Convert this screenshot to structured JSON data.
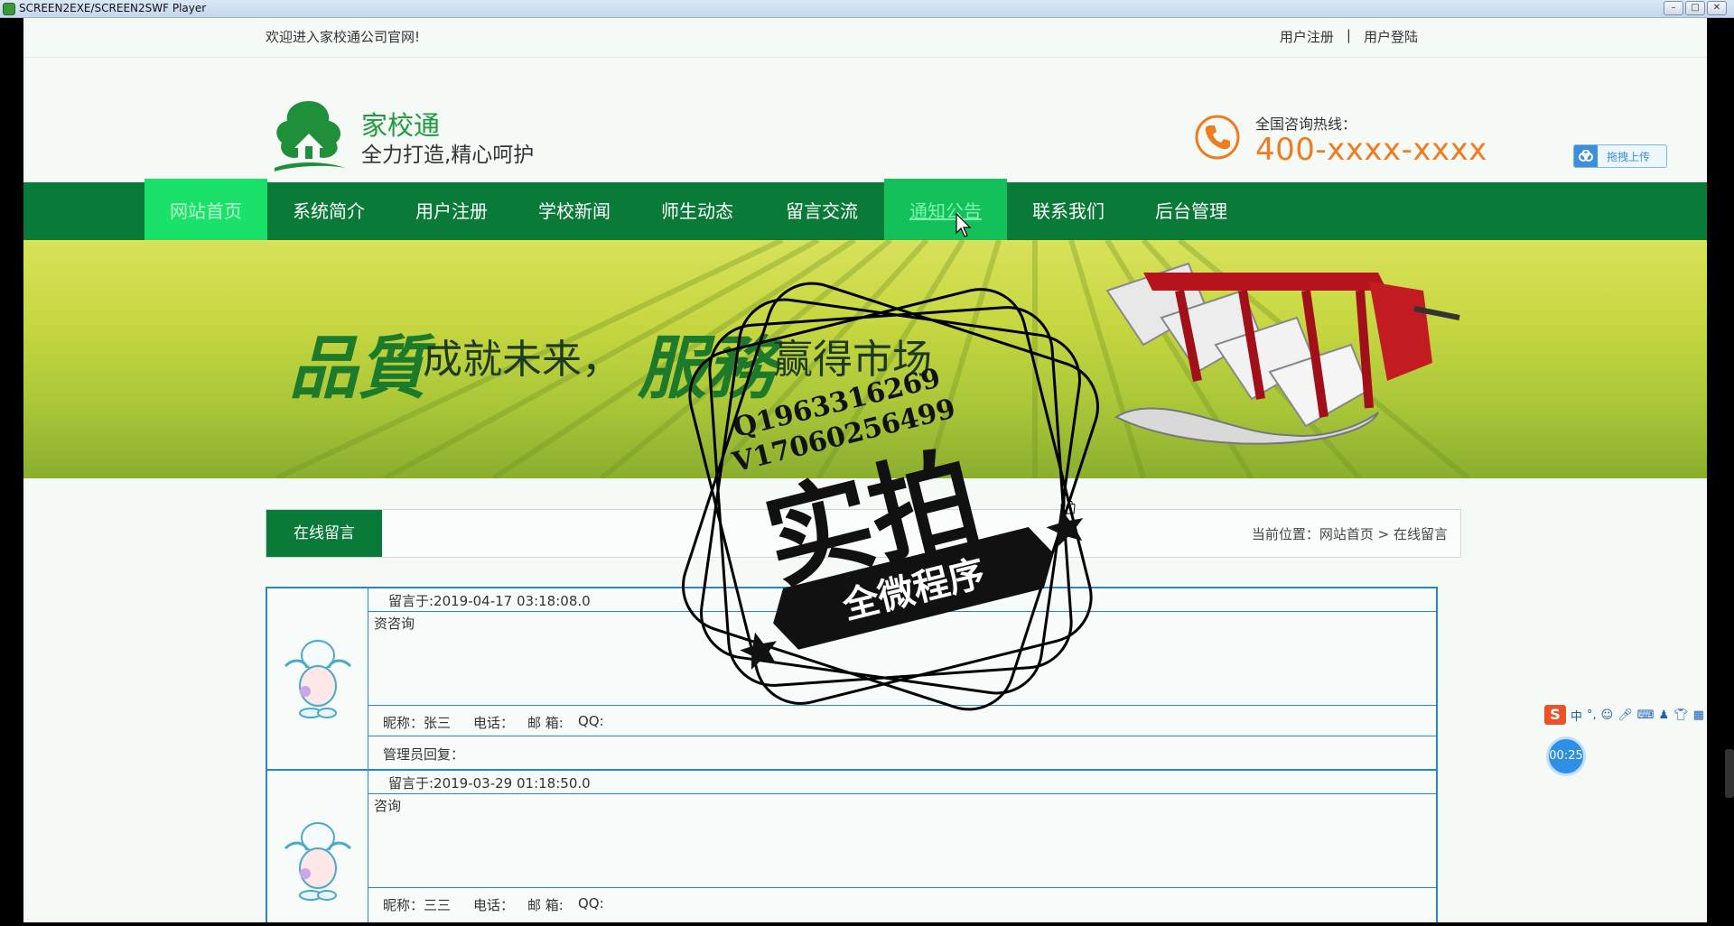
{
  "window": {
    "title": "SCREEN2EXE/SCREEN2SWF Player",
    "buttons": [
      "–",
      "□",
      "✕"
    ]
  },
  "topbar": {
    "welcome": "欢迎进入家校通公司官网!",
    "register": "用户注册",
    "separator": "|",
    "login": "用户登陆"
  },
  "header": {
    "brand_name": "家校通",
    "slogan": "全力打造,精心呵护",
    "hotline_label": "全国咨询热线：",
    "hotline_number": "400-xxxx-xxxx",
    "upload_label": "拖拽上传"
  },
  "nav": {
    "items": [
      {
        "label": "网站首页",
        "state": "active"
      },
      {
        "label": "系统简介",
        "state": "normal"
      },
      {
        "label": "用户注册",
        "state": "normal"
      },
      {
        "label": "学校新闻",
        "state": "normal"
      },
      {
        "label": "师生动态",
        "state": "normal"
      },
      {
        "label": "留言交流",
        "state": "normal"
      },
      {
        "label": "通知公告",
        "state": "hover"
      },
      {
        "label": "联系我们",
        "state": "normal"
      },
      {
        "label": "后台管理",
        "state": "normal"
      }
    ]
  },
  "banner": {
    "text_quality": "品質",
    "text_future": "成就未来，",
    "text_service": "服務",
    "text_market": "赢得市场"
  },
  "watermark": {
    "contact_q": "Q1963316269",
    "contact_v": "V17060256499",
    "big_text": "实拍",
    "ribbon_text": "全微程序"
  },
  "section": {
    "tab_label": "在线留言",
    "breadcrumb_prefix": "当前位置：",
    "breadcrumb_home": "网站首页",
    "breadcrumb_sep": ">",
    "breadcrumb_current": "在线留言"
  },
  "messages": [
    {
      "posted": "留言于:2019-04-17 03:18:08.0",
      "content": "资咨询",
      "nickname": "昵称：张三",
      "phone": "电话：",
      "email": "邮 箱:",
      "qq": "QQ:",
      "reply": "管理员回复："
    },
    {
      "posted": "留言于:2019-03-29 01:18:50.0",
      "content": "咨询",
      "nickname": "昵称：三三",
      "phone": "电话：",
      "email": "邮 箱:",
      "qq": "QQ:"
    }
  ],
  "widgets": {
    "ime_logo": "S",
    "ime_mode": "中",
    "ime_punct": "°,",
    "timer": "00:25"
  },
  "colors": {
    "nav_green": "#097a38",
    "active_green": "#19e16a",
    "hotline_orange": "#f07c1f",
    "border_blue": "#2e86c1"
  }
}
